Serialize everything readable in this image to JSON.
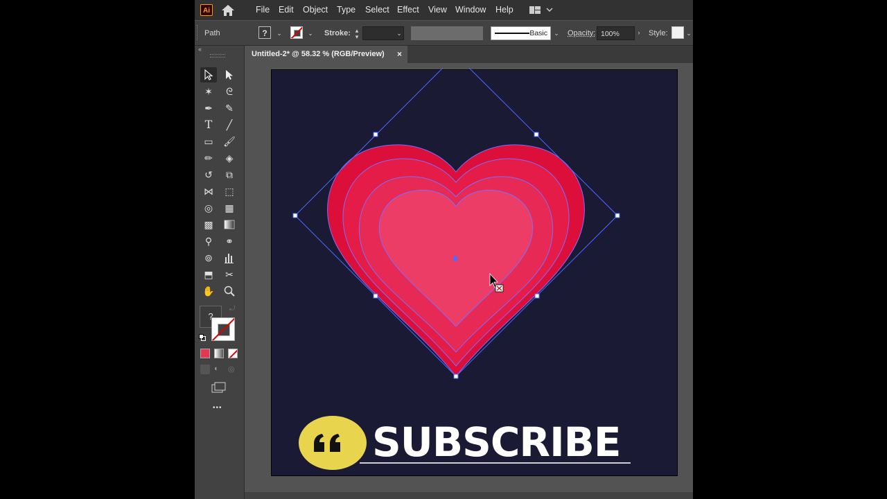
{
  "app": {
    "logo": "Ai",
    "menu": [
      "File",
      "Edit",
      "Object",
      "Type",
      "Select",
      "Effect",
      "View",
      "Window",
      "Help"
    ]
  },
  "control_bar": {
    "selection_type": "Path",
    "fill_symbol": "?",
    "stroke_label": "Stroke:",
    "brush_name": "Basic",
    "opacity_label": "Opacity:",
    "opacity_value": "100%",
    "style_label": "Style:"
  },
  "document": {
    "tab_title": "Untitled-2* @ 58.32 % (RGB/Preview)",
    "close_symbol": "×"
  },
  "toolbox": {
    "fill_symbol": "?",
    "more_symbol": "•••"
  },
  "overlay": {
    "subscribe_text": "SUBSCRIBE",
    "quote_glyph": "❝"
  },
  "colors": {
    "artboard": "#1a1a35",
    "heart_outer": "#dc0f3a",
    "heart_2": "#e41c47",
    "heart_3": "#e72a55",
    "heart_inner": "#ec3d66",
    "selection": "#4a6cff",
    "subscribe_badge": "#e8d44d"
  }
}
